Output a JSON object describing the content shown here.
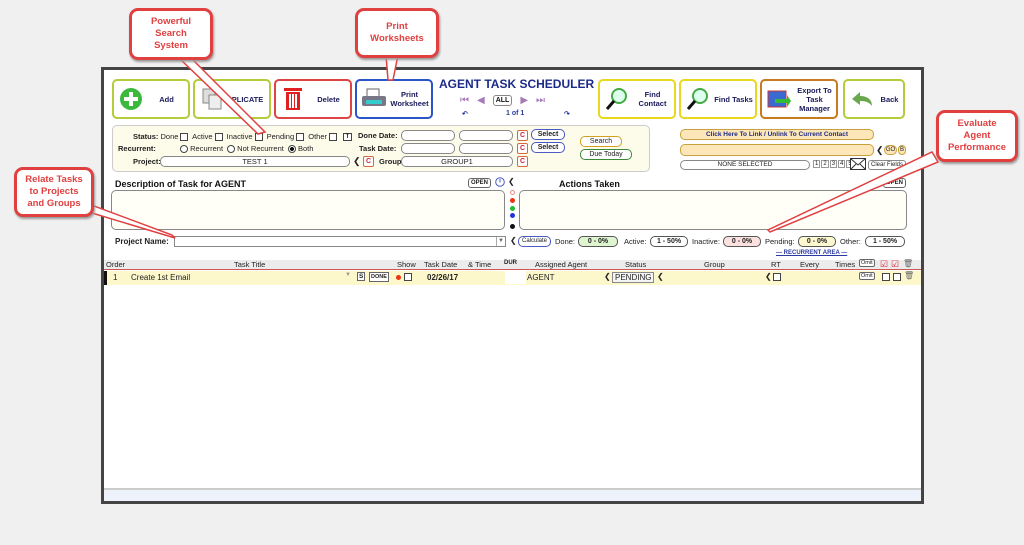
{
  "app": {
    "title": "AGENT TASK SCHEDULER"
  },
  "toolbar": {
    "add": "Add",
    "duplicate": "DUPLICATE",
    "duplicate_visible": "PLICATE",
    "delete": "Delete",
    "print_l1": "Print",
    "print_l2": "Worksheet",
    "find_contact_l1": "Find",
    "find_contact_l2": "Contact",
    "find_tasks": "Find Tasks",
    "export_l1": "Export To",
    "export_l2": "Task Manager",
    "back": "Back"
  },
  "nav": {
    "all": "ALL",
    "record": "1 of 1"
  },
  "search": {
    "status_label": "Status:",
    "status_options": [
      "Done",
      "Active",
      "Inactive",
      "Pending",
      "Other"
    ],
    "t_btn": "T",
    "recurrent_label": "Recurrent:",
    "recurrent_options": [
      "Recurrent",
      "Not Recurrent",
      "Both"
    ],
    "recurrent_selected": "Both",
    "project_label": "Project:",
    "project_value": "TEST 1",
    "done_date_label": "Done Date:",
    "task_date_label": "Task Date:",
    "group_label": "Group:",
    "group_value": "GROUP1",
    "c_btn": "C",
    "select_btn": "Select",
    "search_btn": "Search",
    "due_today_btn": "Due Today"
  },
  "contact": {
    "link_btn": "Click Here To Link / Unlink To Current Contact",
    "go_btn": "GO",
    "b_btn": "B",
    "none_selected": "NONE SELECTED",
    "pages": [
      "1",
      "2",
      "3",
      "4",
      "5"
    ],
    "clear_btn": "Clear Fields"
  },
  "description": {
    "title": "Description of Task for AGENT",
    "open": "OPEN"
  },
  "actions": {
    "title": "Actions Taken",
    "open": "OPEN"
  },
  "colors": {
    "dots": [
      "#ffffff",
      "#ee3311",
      "#22bb33",
      "#2233dd",
      "#111111"
    ]
  },
  "project_name": {
    "label": "Project Name:",
    "value": ""
  },
  "stats": {
    "calculate": "Calculate",
    "done_label": "Done:",
    "done": "0 - 0%",
    "active_label": "Active:",
    "active": "1 - 50%",
    "inactive_label": "Inactive:",
    "inactive": "0 - 0%",
    "pending_label": "Pending:",
    "pending": "0 - 0%",
    "other_label": "Other:",
    "other": "1 - 50%"
  },
  "grid": {
    "recurrent_area": "— RECURRENT AREA —",
    "headers": {
      "order": "Order",
      "title": "Task Title",
      "show": "Show",
      "date": "Task Date",
      "time": "& Time",
      "dur": "DUR",
      "agent": "Assigned Agent",
      "status": "Status",
      "group": "Group",
      "rt": "RT",
      "every": "Every",
      "times": "Times",
      "omit": "Omit"
    },
    "rows": [
      {
        "order": "1",
        "title": "Create 1st Email",
        "s": "S",
        "done": "DONE",
        "date": "02/26/17",
        "agent": "AGENT",
        "status": "PENDING",
        "omit": "Omit"
      }
    ]
  },
  "callouts": {
    "search": [
      "Powerful",
      "Search",
      "System"
    ],
    "print": [
      "Print",
      "Worksheets"
    ],
    "relate": [
      "Relate Tasks",
      "to Projects",
      "and Groups"
    ],
    "evaluate": [
      "Evaluate",
      "Agent",
      "Performance"
    ]
  }
}
